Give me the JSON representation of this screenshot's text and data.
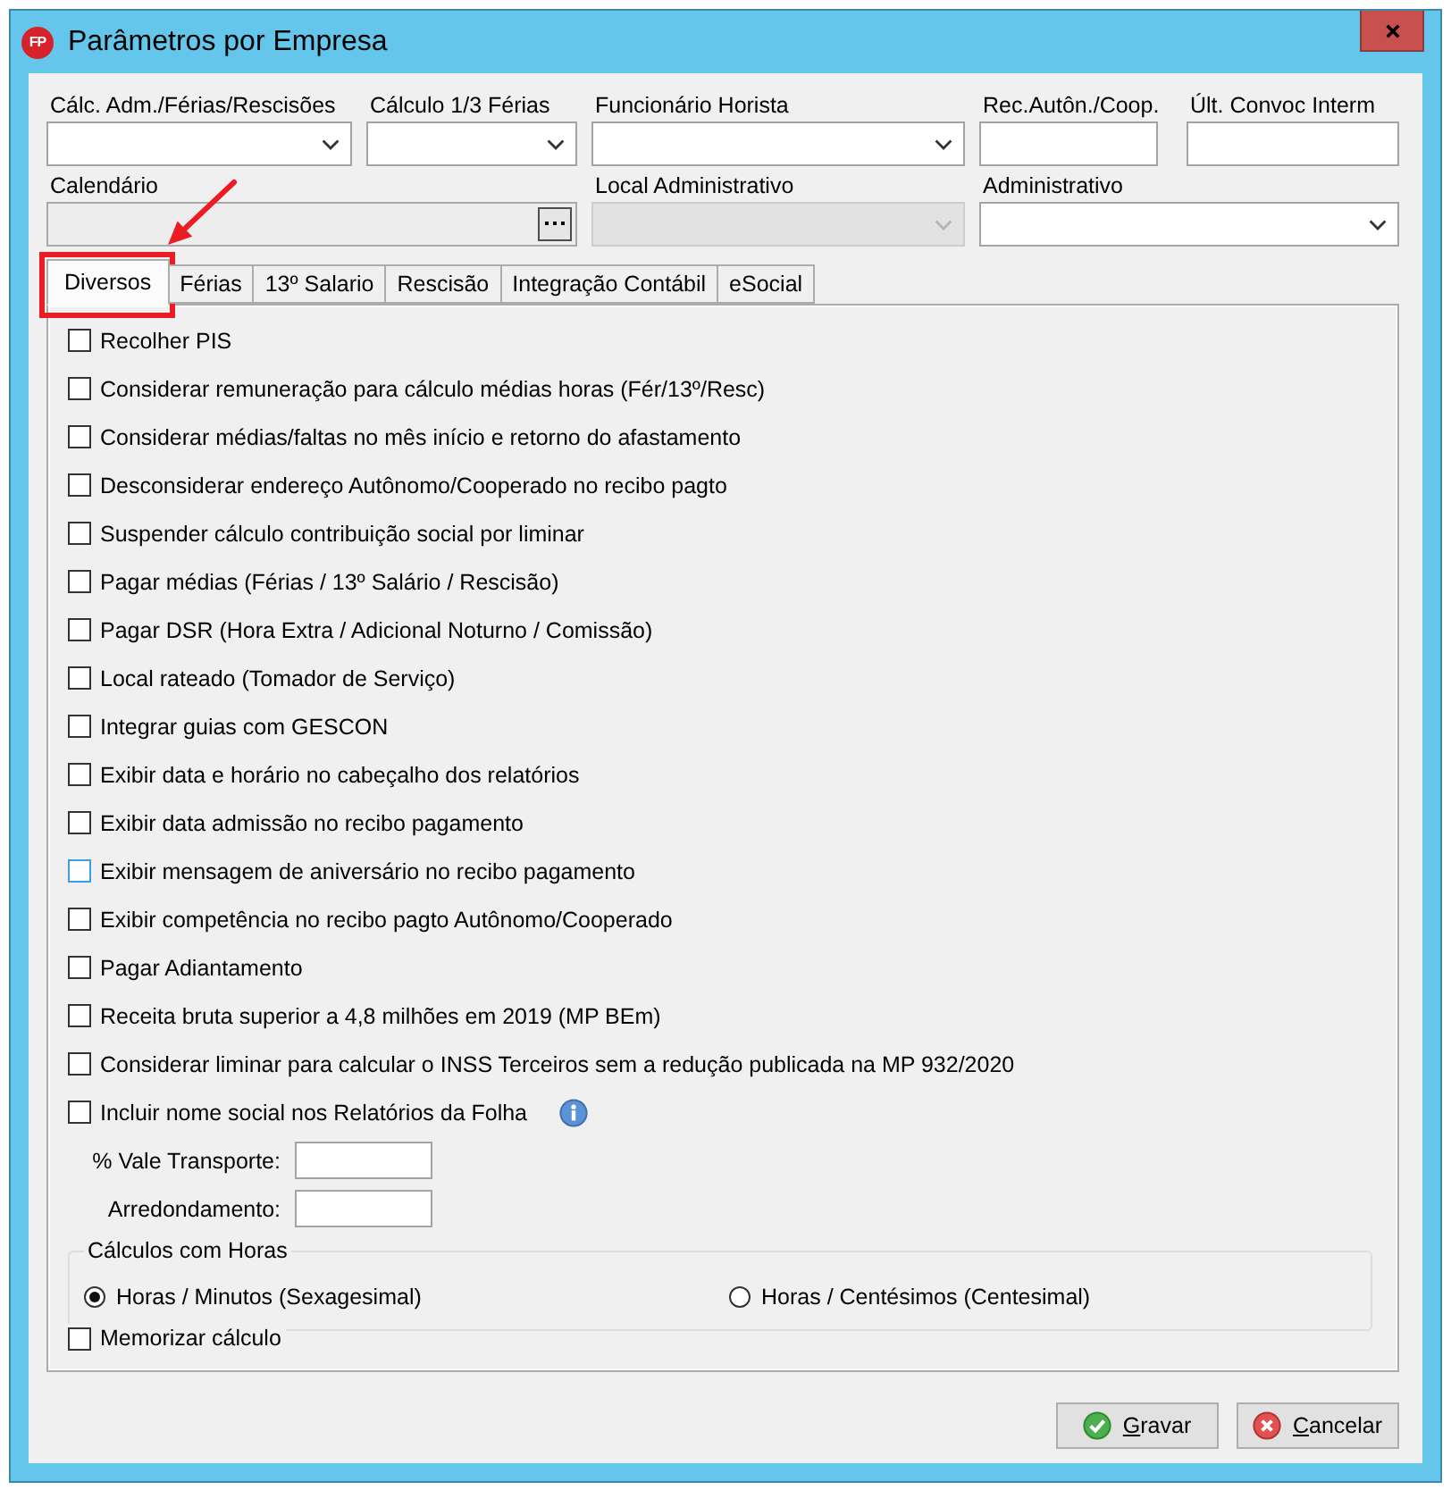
{
  "window": {
    "title": "Parâmetros por Empresa",
    "icon_text": "FP"
  },
  "fields": [
    {
      "label": "Cálc. Adm./Férias/Rescisões",
      "kind": "dropdown",
      "disabled": false
    },
    {
      "label": "Cálculo 1/3 Férias",
      "kind": "dropdown",
      "disabled": false
    },
    {
      "label": "Funcionário Horista",
      "kind": "dropdown",
      "disabled": false
    },
    {
      "label": "Rec.Autôn./Coop.",
      "kind": "text",
      "disabled": false
    },
    {
      "label": "Últ. Convoc Interm",
      "kind": "text",
      "disabled": false
    },
    {
      "label": "Calendário",
      "kind": "lookup",
      "disabled": true
    },
    {
      "label": "Local Administrativo",
      "kind": "dropdown",
      "disabled": true
    },
    {
      "label": "Administrativo",
      "kind": "dropdown",
      "disabled": false
    }
  ],
  "tabs": [
    {
      "label": "Diversos",
      "selected": true,
      "annotated": true
    },
    {
      "label": "Férias",
      "selected": false,
      "annotated": false
    },
    {
      "label": "13º Salario",
      "selected": false,
      "annotated": false
    },
    {
      "label": "Rescisão",
      "selected": false,
      "annotated": false
    },
    {
      "label": "Integração Contábil",
      "selected": false,
      "annotated": false
    },
    {
      "label": "eSocial",
      "selected": false,
      "annotated": false
    }
  ],
  "options": [
    {
      "label": "Recolher PIS",
      "checked": false,
      "hovered": false,
      "info": false
    },
    {
      "label": "Considerar remuneração para cálculo médias horas (Fér/13º/Resc)",
      "checked": false,
      "hovered": false,
      "info": false
    },
    {
      "label": "Considerar médias/faltas no mês início e retorno do afastamento",
      "checked": false,
      "hovered": false,
      "info": false
    },
    {
      "label": "Desconsiderar endereço Autônomo/Cooperado no recibo pagto",
      "checked": false,
      "hovered": false,
      "info": false
    },
    {
      "label": "Suspender cálculo contribuição social por liminar",
      "checked": false,
      "hovered": false,
      "info": false
    },
    {
      "label": "Pagar médias (Férias / 13º Salário / Rescisão)",
      "checked": false,
      "hovered": false,
      "info": false
    },
    {
      "label": "Pagar DSR (Hora Extra / Adicional Noturno / Comissão)",
      "checked": false,
      "hovered": false,
      "info": false
    },
    {
      "label": "Local rateado (Tomador de Serviço)",
      "checked": false,
      "hovered": false,
      "info": false
    },
    {
      "label": "Integrar guias com GESCON",
      "checked": false,
      "hovered": false,
      "info": false
    },
    {
      "label": "Exibir data e horário no cabeçalho dos relatórios",
      "checked": false,
      "hovered": false,
      "info": false
    },
    {
      "label": "Exibir data admissão no recibo pagamento",
      "checked": false,
      "hovered": false,
      "info": false
    },
    {
      "label": "Exibir mensagem de aniversário no recibo pagamento",
      "checked": false,
      "hovered": true,
      "info": false
    },
    {
      "label": "Exibir competência no recibo pagto Autônomo/Cooperado",
      "checked": false,
      "hovered": false,
      "info": false
    },
    {
      "label": "Pagar Adiantamento",
      "checked": false,
      "hovered": false,
      "info": false
    },
    {
      "label": "Receita bruta superior a 4,8 milhões em 2019 (MP BEm)",
      "checked": false,
      "hovered": false,
      "info": false
    },
    {
      "label": "Considerar liminar para calcular o INSS Terceiros sem a redução publicada na MP 932/2020",
      "checked": false,
      "hovered": false,
      "info": false
    },
    {
      "label": "Incluir nome social nos Relatórios da Folha",
      "checked": false,
      "hovered": false,
      "info": true
    }
  ],
  "numeric_fields": [
    {
      "label": "% Vale Transporte:"
    },
    {
      "label": "Arredondamento:"
    }
  ],
  "hours_group": {
    "title": "Cálculos com Horas",
    "options": [
      {
        "label": "Horas / Minutos (Sexagesimal)",
        "selected": true
      },
      {
        "label": "Horas / Centésimos (Centesimal)",
        "selected": false
      }
    ]
  },
  "memorize": {
    "label": "Memorizar cálculo",
    "checked": false
  },
  "buttons": [
    {
      "label": "Gravar",
      "kind": "save"
    },
    {
      "label": "Cancelar",
      "kind": "cancel"
    }
  ]
}
